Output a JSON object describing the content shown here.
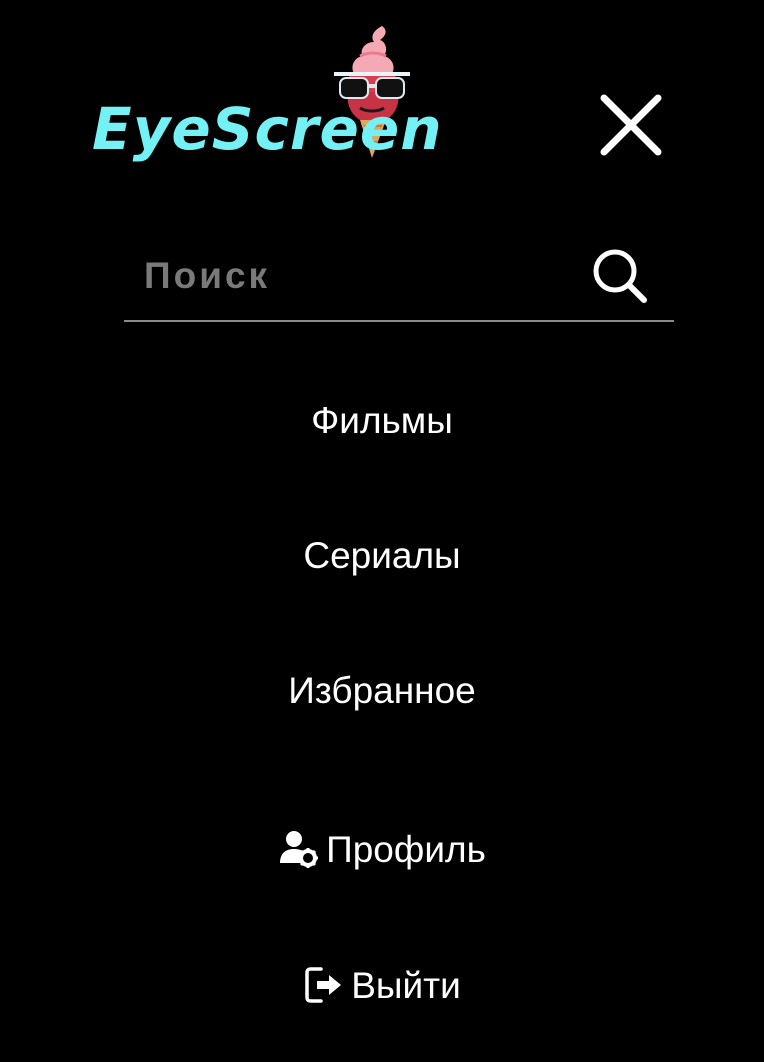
{
  "brand": {
    "name": "EyeScreen",
    "logo_color": "#73f1f4",
    "mascot_icon": "ice-cream-sunglasses-icon"
  },
  "header": {
    "close_icon": "close-icon"
  },
  "search": {
    "placeholder": "Поиск",
    "value": "",
    "icon": "search-icon"
  },
  "nav": {
    "movies": "Фильмы",
    "series": "Сериалы",
    "favorites": "Избранное",
    "profile": "Профиль",
    "logout": "Выйти"
  },
  "icons": {
    "profile": "user-gear-icon",
    "logout": "sign-out-icon"
  },
  "colors": {
    "background": "#000000",
    "text": "#ffffff",
    "placeholder": "#7a7a7a",
    "divider": "#8a8a8a"
  }
}
